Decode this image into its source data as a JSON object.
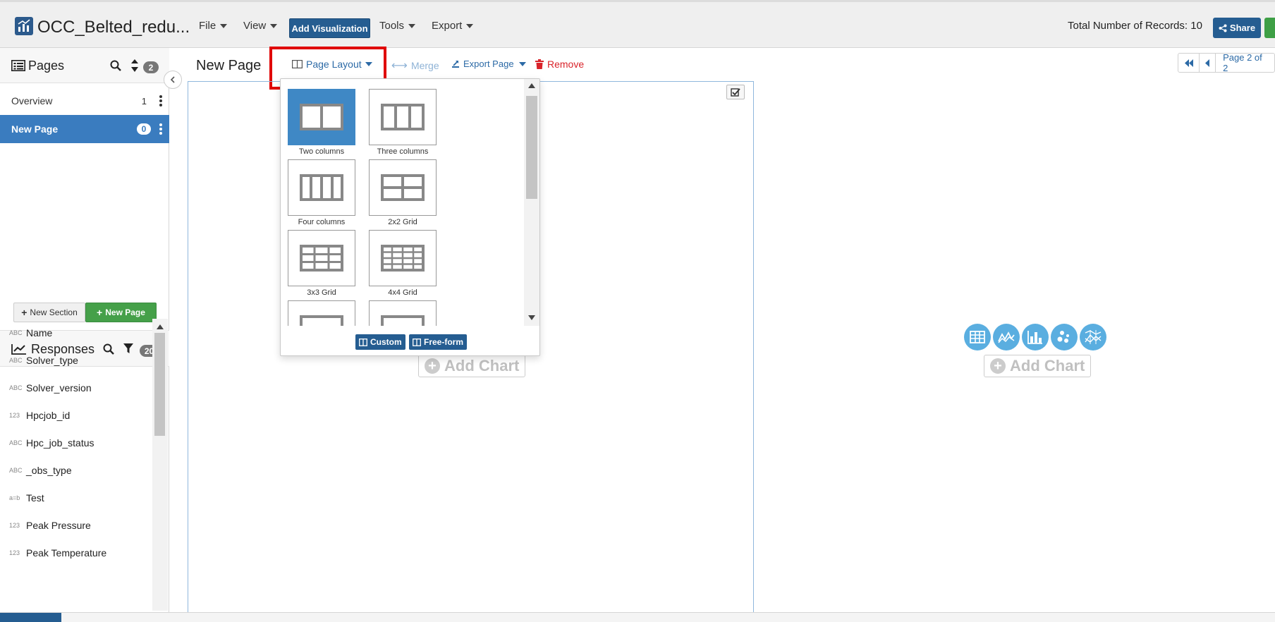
{
  "app": {
    "title": "OCC_Belted_redu...",
    "menus": [
      {
        "label": "File"
      },
      {
        "label": "View"
      },
      {
        "label": "Tools"
      },
      {
        "label": "Export"
      }
    ],
    "add_visualization_label": "Add Visualization",
    "records_label": "Total Number of Records: 10",
    "share_label": "Share"
  },
  "sidebar": {
    "pages_title": "Pages",
    "pages_count": "2",
    "pages": [
      {
        "label": "Overview",
        "count": "1",
        "active": false
      },
      {
        "label": "New Page",
        "count": "0",
        "active": true
      }
    ],
    "new_section_label": "New Section",
    "new_page_label": "New Page",
    "responses_title": "Responses",
    "responses_count": "20",
    "responses": [
      {
        "type": "ABC",
        "name": "Name"
      },
      {
        "type": "ABC",
        "name": "Solver_type"
      },
      {
        "type": "ABC",
        "name": "Solver_version"
      },
      {
        "type": "123",
        "name": "Hpcjob_id"
      },
      {
        "type": "ABC",
        "name": "Hpc_job_status"
      },
      {
        "type": "ABC",
        "name": "_obs_type"
      },
      {
        "type": "a=b",
        "name": "Test"
      },
      {
        "type": "123",
        "name": "Peak Pressure"
      },
      {
        "type": "123",
        "name": "Peak Temperature"
      }
    ]
  },
  "toolbar": {
    "page_title": "New Page",
    "page_layout_label": "Page Layout",
    "merge_label": "Merge",
    "export_page_label": "Export Page",
    "remove_label": "Remove",
    "pagination_label": "Page 2 of 2"
  },
  "layout_menu": {
    "options": [
      {
        "label": "Two columns",
        "selected": true
      },
      {
        "label": "Three columns",
        "selected": false
      },
      {
        "label": "Four columns",
        "selected": false
      },
      {
        "label": "2x2 Grid",
        "selected": false
      },
      {
        "label": "3x3 Grid",
        "selected": false
      },
      {
        "label": "4x4 Grid",
        "selected": false
      }
    ],
    "custom_label": "Custom",
    "freeform_label": "Free-form"
  },
  "panels": {
    "add_chart_label": "Add Chart",
    "chart_type_icons": [
      "table-icon",
      "line-chart-icon",
      "bar-chart-icon",
      "scatter-icon",
      "parallel-coordinates-icon"
    ]
  },
  "colors": {
    "primary": "#255d91",
    "active": "#3a7cbf",
    "success": "#45a049",
    "danger": "#d9232a",
    "highlight": "#e00000",
    "chart_icon": "#5aaee0"
  }
}
